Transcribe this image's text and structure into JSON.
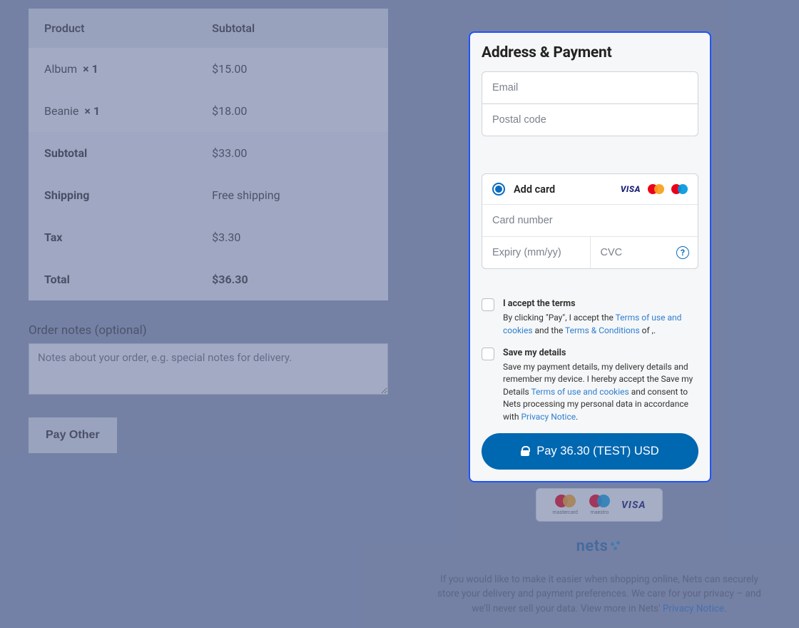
{
  "order": {
    "headers": {
      "product": "Product",
      "subtotal": "Subtotal"
    },
    "items": [
      {
        "name": "Album",
        "qty": "× 1",
        "price": "$15.00"
      },
      {
        "name": "Beanie",
        "qty": "× 1",
        "price": "$18.00"
      }
    ],
    "subtotal_label": "Subtotal",
    "subtotal_value": "$33.00",
    "shipping_label": "Shipping",
    "shipping_value": "Free shipping",
    "tax_label": "Tax",
    "tax_value": "$3.30",
    "total_label": "Total",
    "total_value": "$36.30"
  },
  "notes": {
    "label": "Order notes (optional)",
    "placeholder": "Notes about your order, e.g. special notes for delivery."
  },
  "pay_other_label": "Pay Other",
  "panel": {
    "title": "Address & Payment",
    "email_placeholder": "Email",
    "postal_placeholder": "Postal code",
    "add_card_label": "Add card",
    "cardnumber_placeholder": "Card number",
    "expiry_placeholder": "Expiry (mm/yy)",
    "cvc_placeholder": "CVC",
    "terms": {
      "title": "I accept the terms",
      "pre": "By clicking \"Pay\", I accept the ",
      "link1": "Terms of use and cookies",
      "mid": " and the ",
      "link2": "Terms & Conditions",
      "post": " of ,."
    },
    "save": {
      "title": "Save my details",
      "t1": "Save my payment details, my delivery details and remember my device. I hereby accept the Save my Details ",
      "link1": "Terms of use and cookies",
      "t2": " and consent to Nets processing my personal data in accordance with ",
      "link2": "Privacy Notice",
      "t3": "."
    },
    "pay_button": "Pay 36.30 (TEST) USD"
  },
  "card_brand_labels": {
    "mastercard": "mastercard",
    "maestro": "maestro"
  },
  "nets_text": "nets",
  "footer": {
    "text1": "If you would like to make it easier when shopping online, Nets can securely store your delivery and payment preferences. We care for your privacy – and we'll never sell your data. View more in Nets' ",
    "link": "Privacy Notice",
    "text2": "."
  }
}
